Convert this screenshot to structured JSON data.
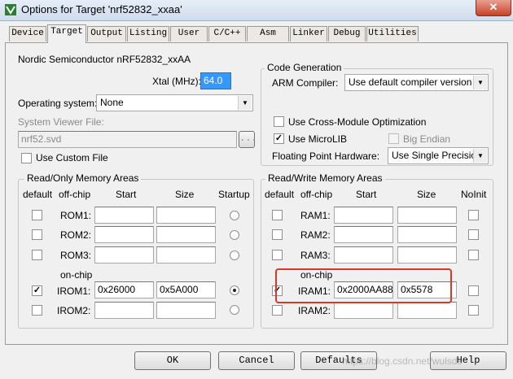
{
  "window": {
    "title": "Options for Target 'nrf52832_xxaa'",
    "close_glyph": "✕"
  },
  "tabs": [
    "Device",
    "Target",
    "Output",
    "Listing",
    "User",
    "C/C++",
    "Asm",
    "Linker",
    "Debug",
    "Utilities"
  ],
  "device_name": "Nordic Semiconductor nRF52832_xxAA",
  "xtal": {
    "label": "Xtal (MHz):",
    "value": "64.0"
  },
  "os": {
    "label": "Operating system:",
    "value": "None"
  },
  "svd": {
    "label": "System Viewer File:",
    "value": "nrf52.svd",
    "browse": "...",
    "custom_label": "Use Custom File"
  },
  "code_gen": {
    "title": "Code Generation",
    "compiler_label": "ARM Compiler:",
    "compiler_value": "Use default compiler version",
    "cross_module": "Use Cross-Module Optimization",
    "microlib": "Use MicroLIB",
    "big_endian": "Big Endian",
    "fp_label": "Floating Point Hardware:",
    "fp_value": "Use Single Precision"
  },
  "ro_memory": {
    "title": "Read/Only Memory Areas",
    "headers": {
      "default": "default",
      "offchip": "off-chip",
      "start": "Start",
      "size": "Size",
      "startup": "Startup"
    },
    "onchip_label": "on-chip",
    "rows": [
      {
        "name": "ROM1:",
        "start": "",
        "size": "",
        "default": false,
        "startup": false
      },
      {
        "name": "ROM2:",
        "start": "",
        "size": "",
        "default": false,
        "startup": false
      },
      {
        "name": "ROM3:",
        "start": "",
        "size": "",
        "default": false,
        "startup": false
      },
      {
        "name": "IROM1:",
        "start": "0x26000",
        "size": "0x5A000",
        "default": true,
        "startup": true
      },
      {
        "name": "IROM2:",
        "start": "",
        "size": "",
        "default": false,
        "startup": false
      }
    ]
  },
  "rw_memory": {
    "title": "Read/Write Memory Areas",
    "headers": {
      "default": "default",
      "offchip": "off-chip",
      "start": "Start",
      "size": "Size",
      "noinit": "NoInit"
    },
    "onchip_label": "on-chip",
    "rows": [
      {
        "name": "RAM1:",
        "start": "",
        "size": "",
        "default": false
      },
      {
        "name": "RAM2:",
        "start": "",
        "size": "",
        "default": false
      },
      {
        "name": "RAM3:",
        "start": "",
        "size": "",
        "default": false
      },
      {
        "name": "IRAM1:",
        "start": "0x2000AA88",
        "size": "0x5578",
        "default": true
      },
      {
        "name": "IRAM2:",
        "start": "",
        "size": "",
        "default": false
      }
    ]
  },
  "buttons": {
    "ok": "OK",
    "cancel": "Cancel",
    "defaults": "Defaults",
    "help": "Help"
  },
  "watermark": "https://blog.csdn.net/wulsds",
  "colors": {
    "highlight": "#d33a2c",
    "selection": "#3399ff"
  }
}
